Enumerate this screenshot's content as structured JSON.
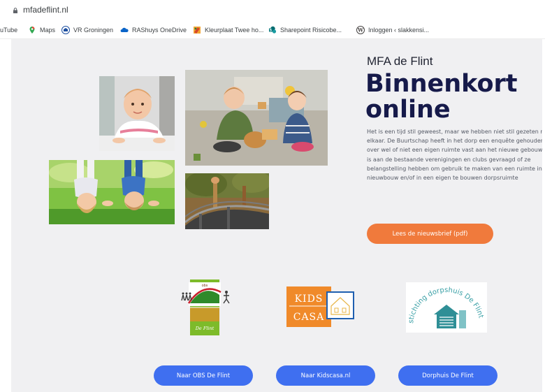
{
  "browser": {
    "url": "mfadeflint.nl",
    "bookmarks": [
      {
        "label": "uTube",
        "icon": "youtube-icon"
      },
      {
        "label": "Maps",
        "icon": "maps-pin-icon"
      },
      {
        "label": "VR Groningen",
        "icon": "vr-groningen-icon"
      },
      {
        "label": "RAShuys OneDrive",
        "icon": "onedrive-cloud-icon"
      },
      {
        "label": "Kleurplaat Twee ho...",
        "icon": "kleurplaat-icon"
      },
      {
        "label": "Sharepoint Risicobe...",
        "icon": "sharepoint-icon"
      },
      {
        "label": "Inloggen ‹ slakkensi...",
        "icon": "wordpress-icon"
      }
    ]
  },
  "hero": {
    "brand": "MFA de Flint",
    "headline": "Binnenkort online",
    "intro": "Het is een tijd stil geweest, maar we hebben niet stil gezeten met elkaar. De Buurtschap heeft in het dorp een enquête gehouden over wel of niet een eigen ruimte vast aan het nieuwe gebouw. Er is aan de bestaande verenigingen en clubs gevraagd of ze belangstelling hebben om gebruik te maken van een ruimte in de nieuwbouw en/of in een eigen te bouwen dorpsruimte",
    "newsletter_button": "Lees de nieuwsbrief (pdf)"
  },
  "logos": {
    "obs": {
      "top_text": "obs",
      "bottom_text": "De Flint"
    },
    "kidscasa": {
      "line1": "KIDS",
      "line2": "CASA"
    },
    "dorpshuis": {
      "text": "stichting dorpshuis De Flint"
    }
  },
  "links": [
    {
      "label": "Naar OBS De Flint"
    },
    {
      "label": "Naar Kidscasa.nl"
    },
    {
      "label": "Dorphuis De Flint"
    }
  ],
  "colors": {
    "accent_orange": "#f07a3c",
    "accent_blue": "#3f6ff0",
    "headline_navy": "#161a4a",
    "page_background": "#f0f0f2"
  }
}
